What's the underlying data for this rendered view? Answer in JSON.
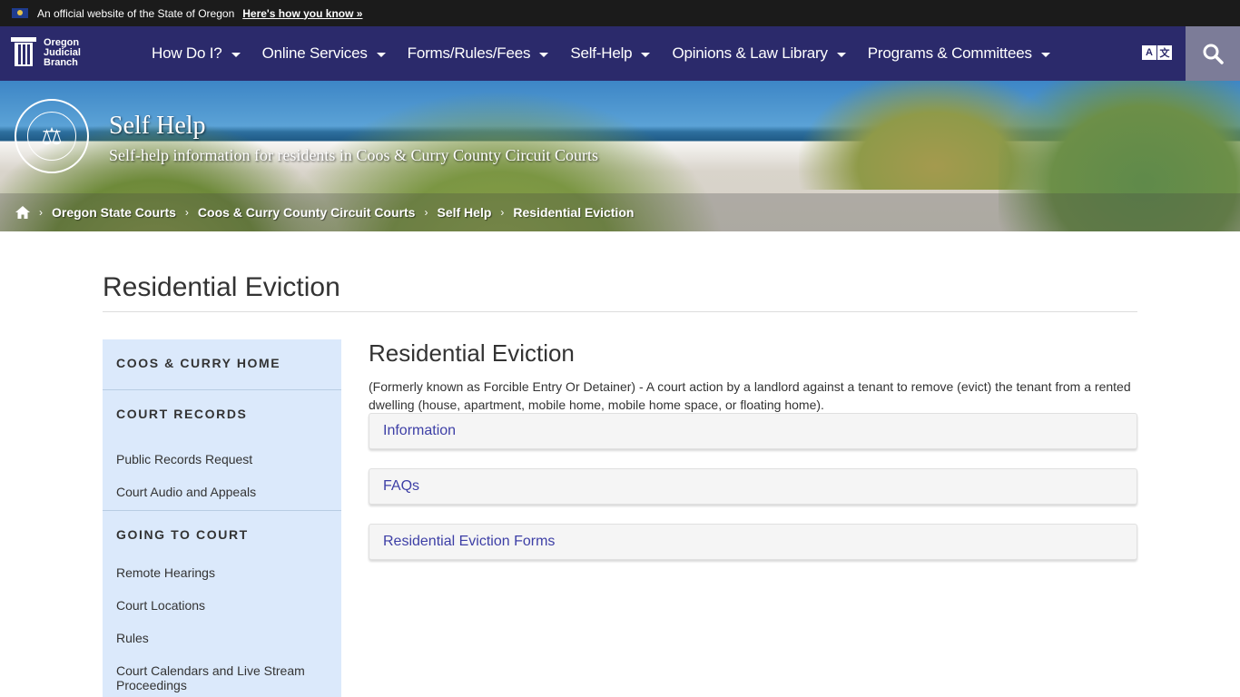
{
  "gov_banner": {
    "text": "An official website of the State of Oregon",
    "link": "Here's how you know »"
  },
  "logo": {
    "line1": "Oregon",
    "line2": "Judicial",
    "line3": "Branch"
  },
  "nav": {
    "items": [
      {
        "label": "How Do I?"
      },
      {
        "label": "Online Services"
      },
      {
        "label": "Forms/Rules/Fees"
      },
      {
        "label": "Self-Help"
      },
      {
        "label": "Opinions & Law Library"
      },
      {
        "label": "Programs & Committees"
      }
    ],
    "translate_a": "A",
    "translate_b": "文",
    "search_icon": "search-icon"
  },
  "hero": {
    "title": "Self Help",
    "subtitle": "Self-help information for residents in Coos & Curry County Circuit Courts",
    "seal_icon": "scales-of-justice"
  },
  "breadcrumb": {
    "home_icon": "home-icon",
    "items": [
      {
        "label": "Oregon State Courts"
      },
      {
        "label": "Coos & Curry County Circuit Courts"
      },
      {
        "label": "Self Help"
      }
    ],
    "current": "Residential Eviction",
    "separator": "›"
  },
  "page": {
    "title": "Residential Eviction"
  },
  "sidebar": {
    "sections": [
      {
        "heading": "COOS & CURRY HOME",
        "links": []
      },
      {
        "heading": "COURT RECORDS",
        "links": [
          "Public Records Request",
          "Court Audio and Appeals"
        ]
      },
      {
        "heading": "GOING TO COURT",
        "links": [
          "Remote Hearings",
          "Court Locations",
          "Rules",
          "Court Calendars and Live Stream Proceedings"
        ]
      }
    ]
  },
  "content": {
    "title": "Residential Eviction",
    "description": "(Formerly known as Forcible Entry Or Detainer) - A court action by a landlord against a tenant to remove (evict) the tenant from a rented dwelling (house, apartment, mobile home, mobile home space, or floating home).",
    "accordions": [
      {
        "label": "Information"
      },
      {
        "label": "FAQs"
      },
      {
        "label": "Residential Eviction Forms"
      }
    ]
  },
  "colors": {
    "nav_bg": "#2b2a6b",
    "banner_bg": "#1b1b1b",
    "search_bg": "#7c7c98",
    "sidebar_bg": "#dbe9fb",
    "accordion_link": "#3d3fa6"
  }
}
